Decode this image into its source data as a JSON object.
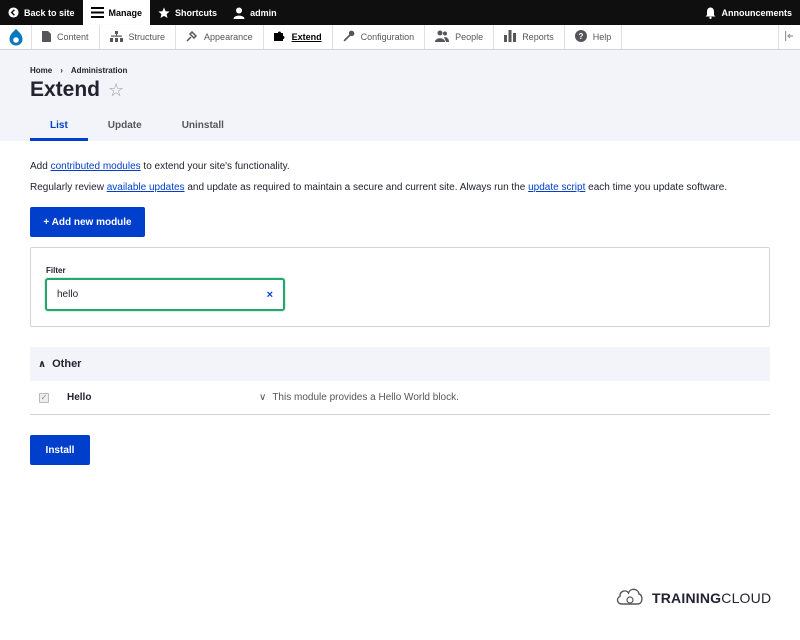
{
  "toolbar": {
    "back_label": "Back to site",
    "manage_label": "Manage",
    "shortcuts_label": "Shortcuts",
    "user_label": "admin",
    "announcements_label": "Announcements"
  },
  "tray": {
    "items": [
      {
        "label": "Content",
        "icon": "file-icon"
      },
      {
        "label": "Structure",
        "icon": "sitemap-icon"
      },
      {
        "label": "Appearance",
        "icon": "paint-icon"
      },
      {
        "label": "Extend",
        "icon": "puzzle-icon"
      },
      {
        "label": "Configuration",
        "icon": "wrench-icon"
      },
      {
        "label": "People",
        "icon": "people-icon"
      },
      {
        "label": "Reports",
        "icon": "bar-chart-icon"
      },
      {
        "label": "Help",
        "icon": "help-icon"
      }
    ]
  },
  "breadcrumb": {
    "home": "Home",
    "sep": "›",
    "admin": "Administration"
  },
  "page": {
    "title": "Extend",
    "star": "☆"
  },
  "tabs": {
    "list": "List",
    "update": "Update",
    "uninstall": "Uninstall"
  },
  "intro": {
    "line1_pre": "Add ",
    "line1_link": "contributed modules",
    "line1_post": " to extend your site's functionality.",
    "line2_pre": "Regularly review ",
    "line2_link1": "available updates",
    "line2_mid": " and update as required to maintain a secure and current site. Always run the ",
    "line2_link2": "update script",
    "line2_post": " each time you update software."
  },
  "add_module_button": "+ Add new module",
  "filter": {
    "label": "Filter",
    "value": "hello",
    "clear": "×"
  },
  "group": {
    "chevron": "∧",
    "name": "Other"
  },
  "module": {
    "check": "✓",
    "name": "Hello",
    "desc_chevron": "∨",
    "description": "This module provides a Hello World block."
  },
  "install_button": "Install",
  "brand": {
    "part1": "TRAINING",
    "part2": "CLOUD"
  },
  "colors": {
    "accent": "#003ecc",
    "focus": "#26a769",
    "toolbar": "#0f0f0f",
    "header_bg": "#f3f4f9"
  }
}
